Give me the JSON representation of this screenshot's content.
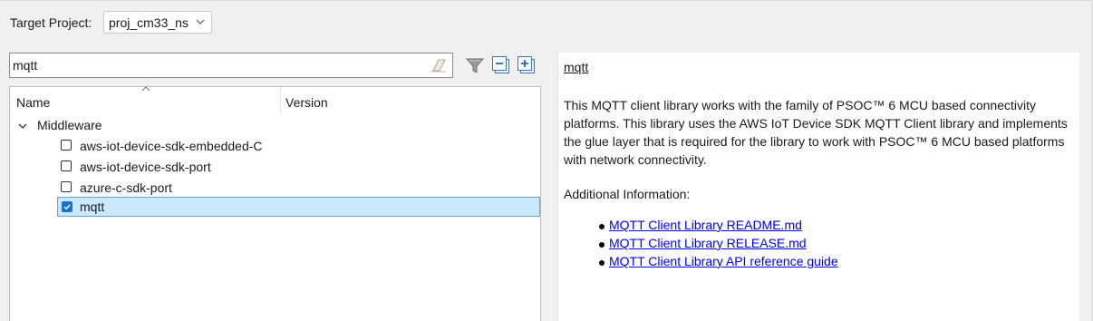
{
  "target_project": {
    "label": "Target Project:",
    "selected": "proj_cm33_ns"
  },
  "search": {
    "value": "mqtt",
    "clear_icon": "eraser-icon"
  },
  "toolbar": {
    "filter_icon": "filter-icon",
    "collapse_all_icon": "collapse-all-icon",
    "expand_all_icon": "expand-all-icon"
  },
  "tree": {
    "columns": [
      "Name",
      "Version"
    ],
    "group": {
      "label": "Middleware",
      "expanded": true,
      "items": [
        {
          "label": "aws-iot-device-sdk-embedded-C",
          "checked": false
        },
        {
          "label": "aws-iot-device-sdk-port",
          "checked": false
        },
        {
          "label": "azure-c-sdk-port",
          "checked": false
        },
        {
          "label": "mqtt",
          "checked": true,
          "selected": true
        }
      ]
    }
  },
  "description": {
    "title": "mqtt",
    "body": "This MQTT client library works with the family of PSOC™ 6 MCU based connectivity platforms. This library uses the AWS IoT Device SDK MQTT Client library and implements the glue layer that is required for the library to work with PSOC™ 6 MCU based platforms with network connectivity.",
    "additional_label": "Additional Information:",
    "links": [
      "MQTT Client Library README.md",
      "MQTT Client Library RELEASE.md",
      "MQTT Client Library API reference guide"
    ]
  },
  "colors": {
    "selection_bg": "#cce8ff",
    "selection_border": "#5aa8e0",
    "link": "#0000ee",
    "checkbox_checked": "#1a73c9"
  }
}
